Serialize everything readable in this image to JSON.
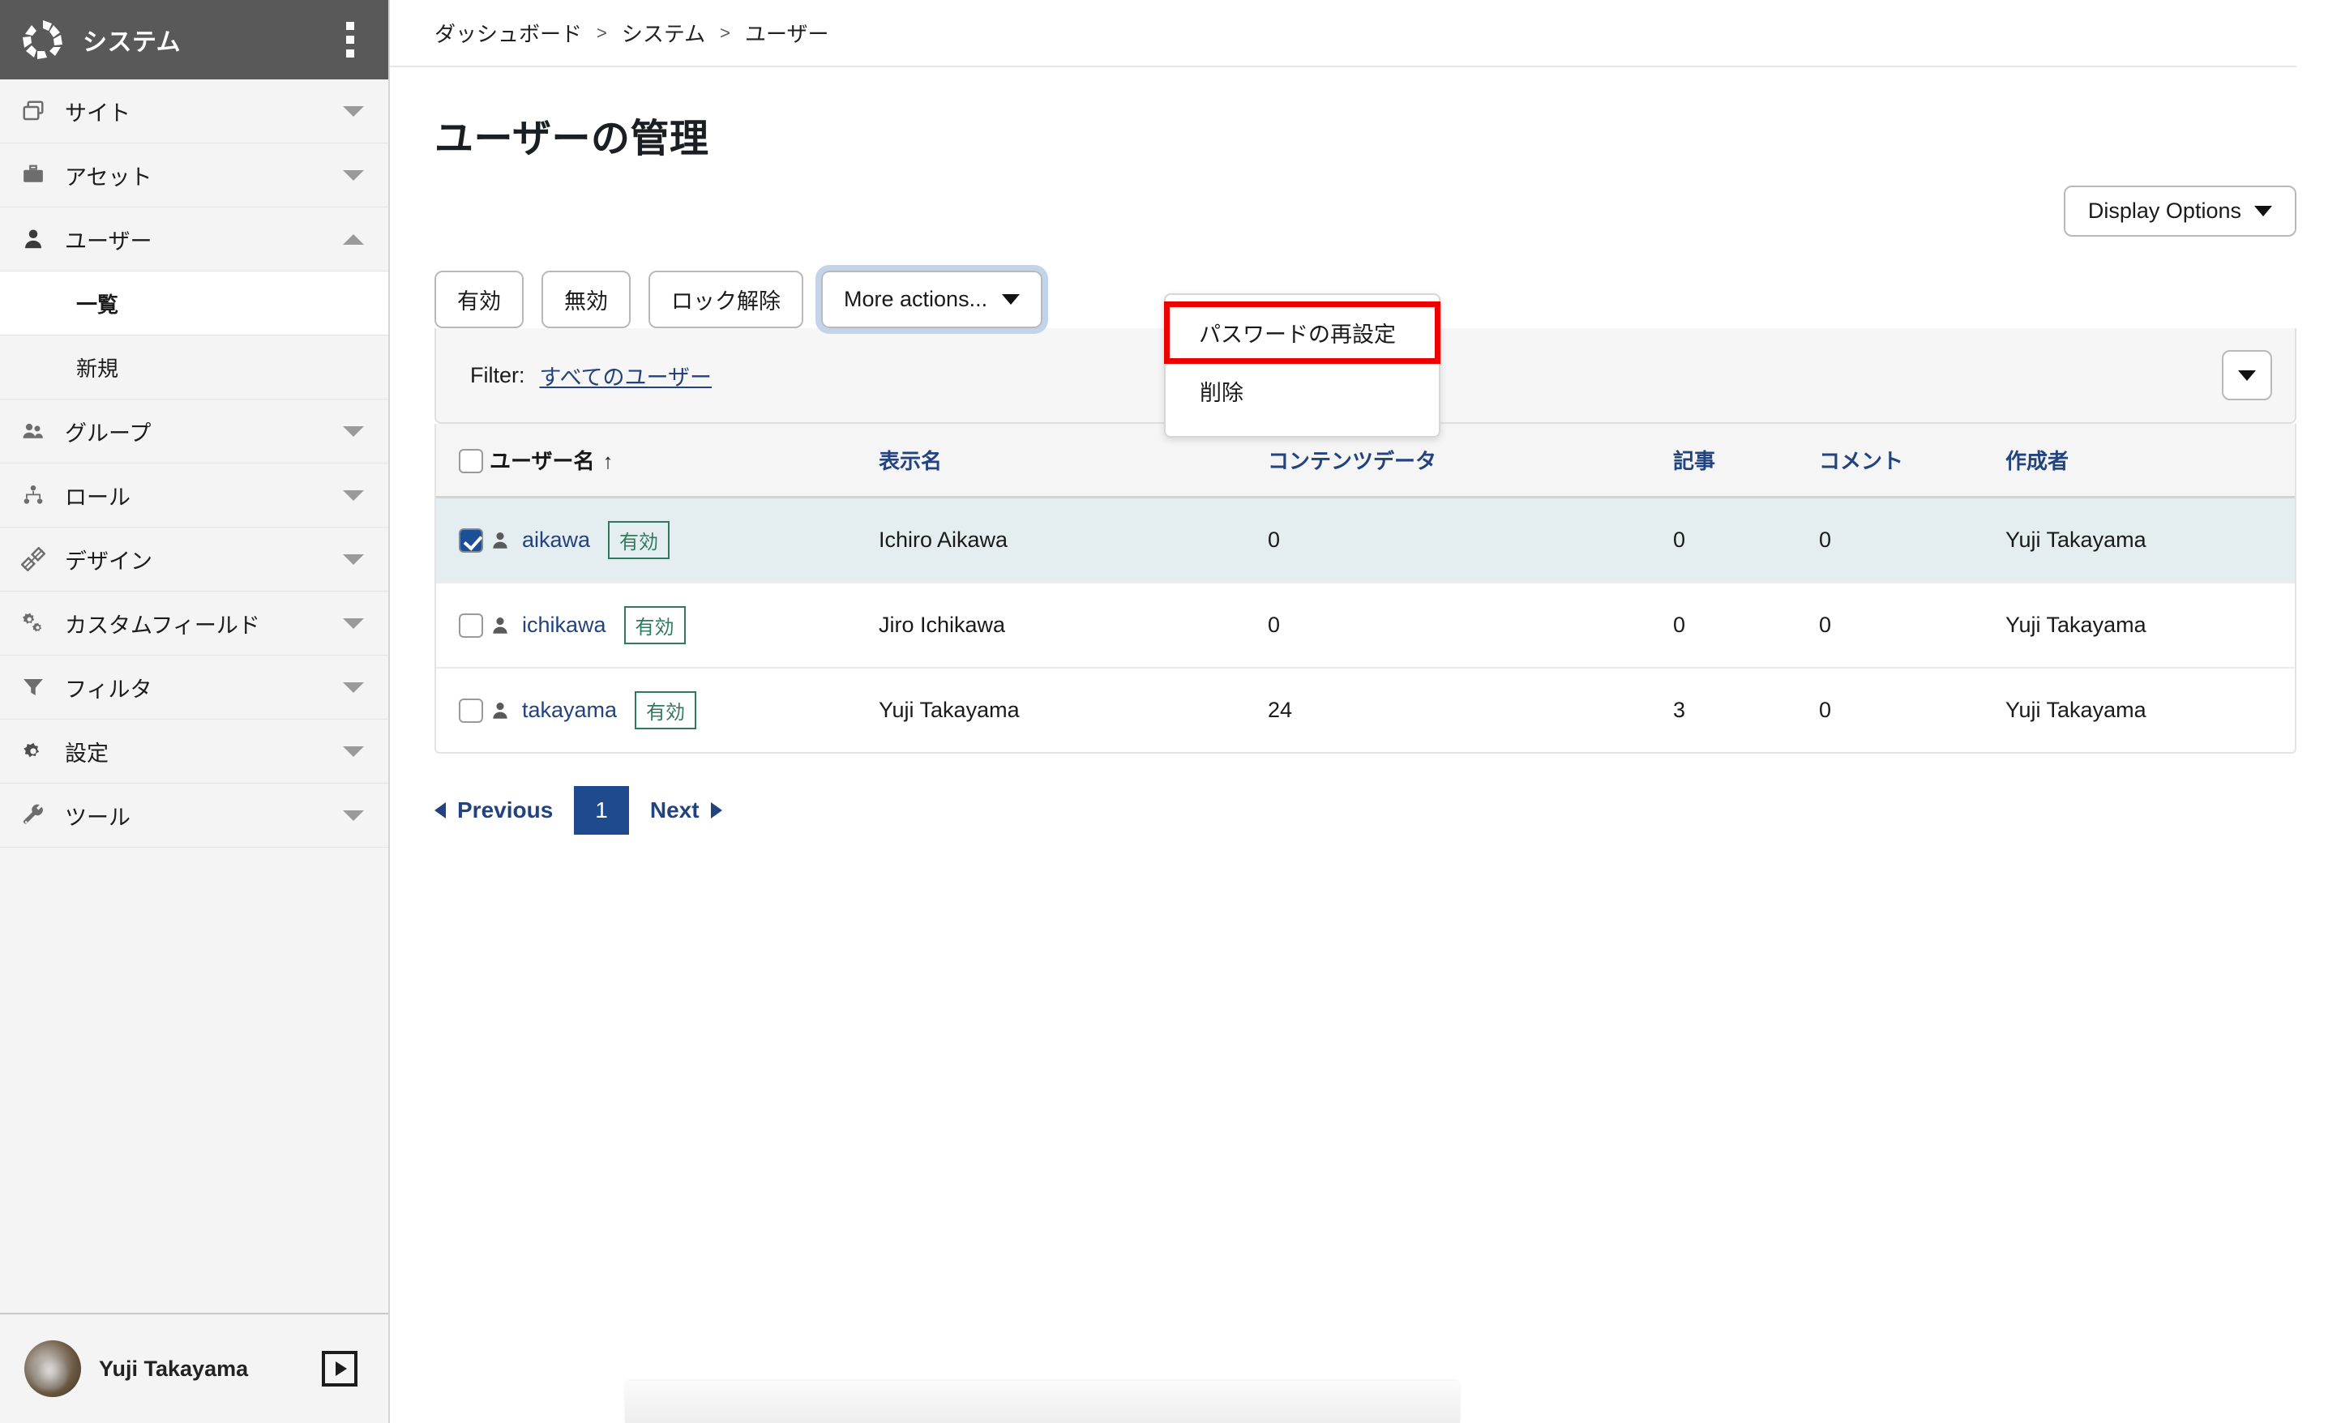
{
  "sidebar": {
    "brand": "システム",
    "kebab_icon": "kebab-menu-icon",
    "items": [
      {
        "label": "サイト",
        "icon": "windows-icon",
        "caret": "down"
      },
      {
        "label": "アセット",
        "icon": "briefcase-icon",
        "caret": "down"
      },
      {
        "label": "ユーザー",
        "icon": "user-icon",
        "caret": "up"
      },
      {
        "label": "グループ",
        "icon": "users-group-icon",
        "caret": "down"
      },
      {
        "label": "ロール",
        "icon": "sitemap-icon",
        "caret": "down"
      },
      {
        "label": "デザイン",
        "icon": "design-ruler-icon",
        "caret": "down"
      },
      {
        "label": "カスタムフィールド",
        "icon": "cogs-icon",
        "caret": "down"
      },
      {
        "label": "フィルタ",
        "icon": "funnel-icon",
        "caret": "down"
      },
      {
        "label": "設定",
        "icon": "gear-icon",
        "caret": "down"
      },
      {
        "label": "ツール",
        "icon": "wrench-icon",
        "caret": "down"
      }
    ],
    "subitems": [
      {
        "label": "一覧",
        "active": true
      },
      {
        "label": "新規",
        "active": false
      }
    ],
    "footer": {
      "user_name": "Yuji Takayama",
      "avatar_icon": "avatar",
      "collapse_icon": "panel-toggle-icon"
    }
  },
  "breadcrumb": {
    "items": [
      "ダッシュボード",
      "システム",
      "ユーザー"
    ],
    "separator": ">"
  },
  "page": {
    "title": "ユーザーの管理"
  },
  "toolbar": {
    "display_options_label": "Display Options",
    "actions": [
      {
        "label": "有効"
      },
      {
        "label": "無効"
      },
      {
        "label": "ロック解除"
      }
    ],
    "more_actions_label": "More actions...",
    "more_actions_menu": [
      {
        "label": "パスワードの再設定",
        "highlighted": true
      },
      {
        "label": "削除",
        "highlighted": false
      }
    ]
  },
  "filter": {
    "label": "Filter:",
    "value": "すべてのユーザー",
    "caret_icon": "chevron-down-icon"
  },
  "table": {
    "columns": [
      {
        "key": "check",
        "label": "",
        "link": false
      },
      {
        "key": "username",
        "label": "ユーザー名",
        "link": false,
        "sort": "↑"
      },
      {
        "key": "display_name",
        "label": "表示名",
        "link": true
      },
      {
        "key": "content_data",
        "label": "コンテンツデータ",
        "link": true
      },
      {
        "key": "articles",
        "label": "記事",
        "link": true
      },
      {
        "key": "comments",
        "label": "コメント",
        "link": true
      },
      {
        "key": "creator",
        "label": "作成者",
        "link": true
      }
    ],
    "rows": [
      {
        "checked": true,
        "username": "aikawa",
        "badge": "有効",
        "display_name": "Ichiro Aikawa",
        "content_data": "0",
        "articles": "0",
        "comments": "0",
        "creator": "Yuji Takayama"
      },
      {
        "checked": false,
        "username": "ichikawa",
        "badge": "有効",
        "display_name": "Jiro Ichikawa",
        "content_data": "0",
        "articles": "0",
        "comments": "0",
        "creator": "Yuji Takayama"
      },
      {
        "checked": false,
        "username": "takayama",
        "badge": "有効",
        "display_name": "Yuji Takayama",
        "content_data": "24",
        "articles": "3",
        "comments": "0",
        "creator": "Yuji Takayama"
      }
    ]
  },
  "pagination": {
    "previous_label": "Previous",
    "next_label": "Next",
    "current_page": "1"
  },
  "colors": {
    "link": "#22437d",
    "accent": "#1f4b8e",
    "selected_row": "#e4eef0",
    "badge": "#2f7a5d",
    "highlight": "#ee0000",
    "sidebar_header": "#595959"
  }
}
